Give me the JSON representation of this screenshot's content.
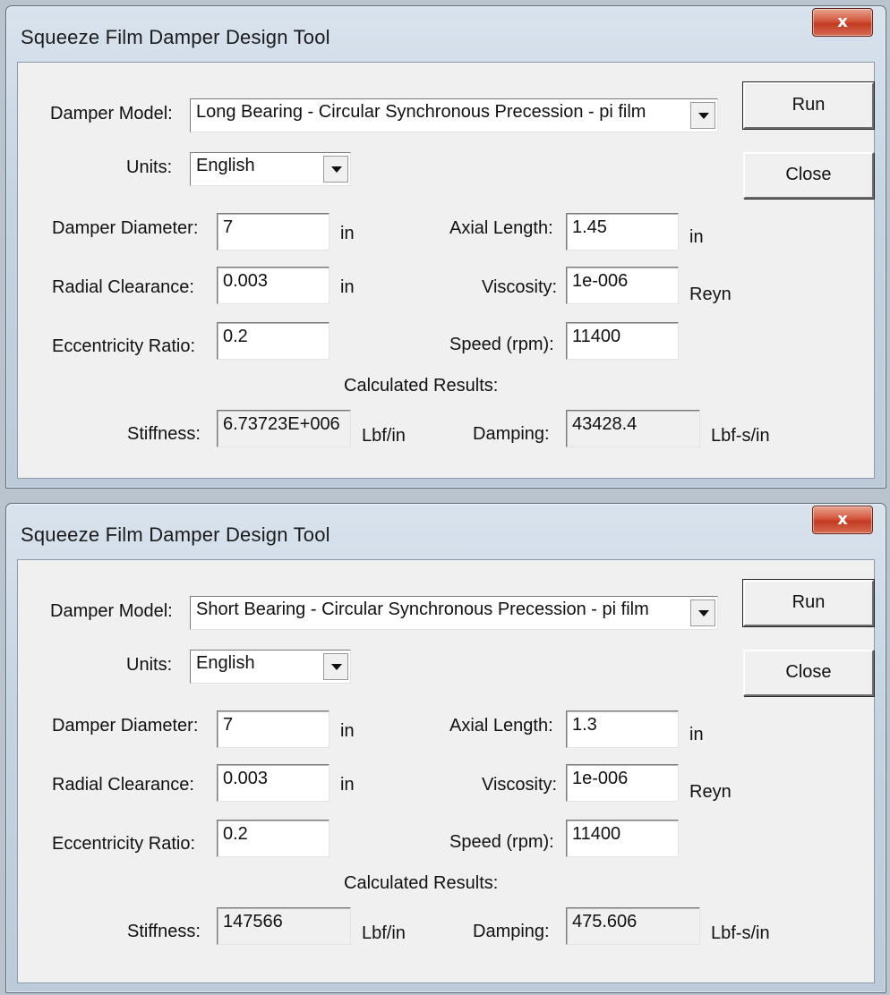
{
  "windows": [
    {
      "title": "Squeeze Film Damper Design Tool",
      "close_glyph": "x",
      "damper_model_label": "Damper Model:",
      "damper_model_value": "Long Bearing - Circular Synchronous Precession -   pi film",
      "units_label": "Units:",
      "units_value": "English",
      "run_label": "Run",
      "close_label": "Close",
      "damper_diameter_label": "Damper Diameter:",
      "damper_diameter_value": "7",
      "damper_diameter_unit": "in",
      "radial_clearance_label": "Radial Clearance:",
      "radial_clearance_value": "0.003",
      "radial_clearance_unit": "in",
      "eccentricity_label": "Eccentricity Ratio:",
      "eccentricity_value": "0.2",
      "axial_length_label": "Axial Length:",
      "axial_length_value": "1.45",
      "axial_length_unit": "in",
      "viscosity_label": "Viscosity:",
      "viscosity_value": "1e-006",
      "viscosity_unit": "Reyn",
      "speed_label": "Speed (rpm):",
      "speed_value": "11400",
      "results_heading": "Calculated Results:",
      "stiffness_label": "Stiffness:",
      "stiffness_value": "6.73723E+006",
      "stiffness_unit": "Lbf/in",
      "damping_label": "Damping:",
      "damping_value": "43428.4",
      "damping_unit": "Lbf-s/in"
    },
    {
      "title": "Squeeze Film Damper Design Tool",
      "close_glyph": "x",
      "damper_model_label": "Damper Model:",
      "damper_model_value": "Short Bearing - Circular Synchronous Precession -   pi film",
      "units_label": "Units:",
      "units_value": "English",
      "run_label": "Run",
      "close_label": "Close",
      "damper_diameter_label": "Damper Diameter:",
      "damper_diameter_value": "7",
      "damper_diameter_unit": "in",
      "radial_clearance_label": "Radial Clearance:",
      "radial_clearance_value": "0.003",
      "radial_clearance_unit": "in",
      "eccentricity_label": "Eccentricity Ratio:",
      "eccentricity_value": "0.2",
      "axial_length_label": "Axial Length:",
      "axial_length_value": "1.3",
      "axial_length_unit": "in",
      "viscosity_label": "Viscosity:",
      "viscosity_value": "1e-006",
      "viscosity_unit": "Reyn",
      "speed_label": "Speed (rpm):",
      "speed_value": "11400",
      "results_heading": "Calculated Results:",
      "stiffness_label": "Stiffness:",
      "stiffness_value": "147566",
      "stiffness_unit": "Lbf/in",
      "damping_label": "Damping:",
      "damping_value": "475.606",
      "damping_unit": "Lbf-s/in"
    }
  ]
}
